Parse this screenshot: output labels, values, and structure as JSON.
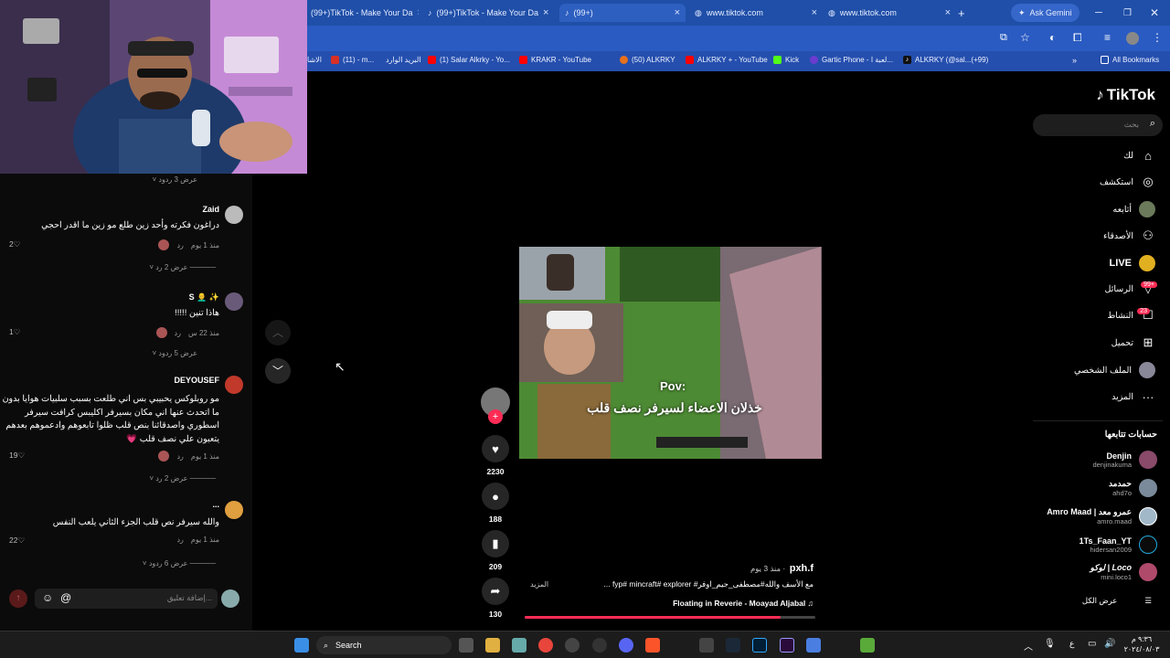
{
  "browser": {
    "tabs": [
      {
        "title": "(99+)TikTok - Make Your Da"
      },
      {
        "title": "(99+)TikTok - Make Your Da"
      },
      {
        "title": "(99+)"
      },
      {
        "title": "www.tiktok.com"
      },
      {
        "title": "www.tiktok.com"
      }
    ],
    "new_tab": "+",
    "ask_gemini": "Ask Gemini",
    "bookmarks": [
      {
        "label": "الاشا",
        "color": "#777"
      },
      {
        "label": "(11) - m...",
        "color": "#d93025"
      },
      {
        "label": "البريد الوارد",
        "color": "#d93025"
      },
      {
        "label": "(1) Salar Alkrky - Yo...",
        "color": "#ff0000"
      },
      {
        "label": "KRAKR - YouTube",
        "color": "#ff0000"
      },
      {
        "label": "(50) ALKRKY",
        "color": "#e8711c"
      },
      {
        "label": "ALKRKY + - YouTube",
        "color": "#ff0000"
      },
      {
        "label": "Kick",
        "color": "#53fc18"
      },
      {
        "label": "Gartic Phone - لعبة ا...",
        "color": "#6c3cd0"
      },
      {
        "label": "ALKRKY (@sal...(+99)",
        "color": "#111"
      }
    ],
    "all_bookmarks": "All Bookmarks"
  },
  "comments": {
    "top_replies": "عرض 3 ردود",
    "items": [
      {
        "author": "Zaid",
        "text": "دراغون فكرته وأحد زين طلع مو زين ما اقدر احجي",
        "time": "منذ 1 يوم",
        "reply": "رد",
        "likes": "2",
        "replies": "عرض 2 رد",
        "avatar_color": "#aaa"
      },
      {
        "author": "S 👨‍🦲 ✨",
        "text": "هاذا تنين !!!!!",
        "time": "منذ 22 س",
        "reply": "رد",
        "likes": "1",
        "replies": "عرض 5 ردود",
        "avatar_color": "#6a5a7a"
      },
      {
        "author": "DEYOUSEF",
        "text": "مو روبلوكس يحبيبي بس اني طلعت بسبب سلبيات هوايا بدون ما اتحدث عنها اني مكان بسيرفر اكليبس كرافت سيرفر اسطوري واصدقائنا بنص قلب ظلوا تابعوهم وادعموهم بعدهم يتعبون علي نصف قلب 💗",
        "time": "منذ 1 يوم",
        "reply": "رد",
        "likes": "19",
        "replies": "عرض 2 رد",
        "avatar_color": "#c0392b"
      },
      {
        "author": "...",
        "text": "والله سيرفر نص قلب الجزء الثاني يلعب النفس",
        "time": "منذ 1 يوم",
        "reply": "رد",
        "likes": "22",
        "replies": "عرض 6 ردود",
        "avatar_color": "#e0a040"
      }
    ],
    "input_placeholder": "إضافة تعليق...",
    "emoji_icon": "☺",
    "mention_icon": "@"
  },
  "nav": {
    "logo": "TikTok",
    "search_placeholder": "بحث",
    "items": [
      {
        "label": "لك",
        "icon": "home-icon",
        "glyph": "⌂"
      },
      {
        "label": "استكشف",
        "icon": "compass-icon",
        "glyph": "◎"
      },
      {
        "label": "أتابعه",
        "icon": "following-avatar-icon",
        "glyph": ""
      },
      {
        "label": "الأصدقاء",
        "icon": "friends-icon",
        "glyph": "👥"
      },
      {
        "label": "LIVE",
        "icon": "live-icon",
        "glyph": ""
      },
      {
        "label": "الرسائل",
        "icon": "messages-icon",
        "glyph": "▽",
        "badge": "99+"
      },
      {
        "label": "النشاط",
        "icon": "activity-icon",
        "glyph": "☐",
        "badge": "23"
      },
      {
        "label": "تحميل",
        "icon": "upload-icon",
        "glyph": "⊞"
      },
      {
        "label": "الملف الشخصي",
        "icon": "profile-avatar-icon",
        "glyph": ""
      },
      {
        "label": "المزيد",
        "icon": "more-icon",
        "glyph": "···"
      }
    ],
    "following_title": "حسابات تتابعها",
    "following": [
      {
        "name": "Denjin",
        "handle": "denjinakuma",
        "color": "#8a4a6a"
      },
      {
        "name": "حمدمد",
        "handle": "ahd7o",
        "color": "#7a8a9a"
      },
      {
        "name": "Amro Maad | عمرو معد",
        "handle": "amro.maad",
        "color": "#a0b8c8"
      },
      {
        "name": "1Ts_Faan_YT",
        "handle": "hidersan2009",
        "color": "#0b0b0b"
      },
      {
        "name": "لوكو | Loco",
        "handle": "mini.loco1",
        "color": "#b04a6a"
      }
    ],
    "show_all": "عرض الكل"
  },
  "video": {
    "overlay_pov": "Pov:",
    "overlay_text": "خذلان الاعضاء لسيرفر نصف قلب",
    "author": "pxh.f",
    "time": "منذ 3 يوم",
    "caption": "مع الأسف والله#مصطفى_جيم_اوفر# fyp# mincraft# explorer ...",
    "more": "المزيد",
    "sound": "Floating in Reverie - Moayad Aljabal",
    "likes": "2230",
    "comments": "188",
    "saves": "209",
    "shares": "130"
  },
  "taskbar": {
    "search": "Search",
    "clock_time": "٩:٣٦ م",
    "clock_date": "٢٠٢٤/٠٨/٠٣",
    "lang": "ع"
  }
}
